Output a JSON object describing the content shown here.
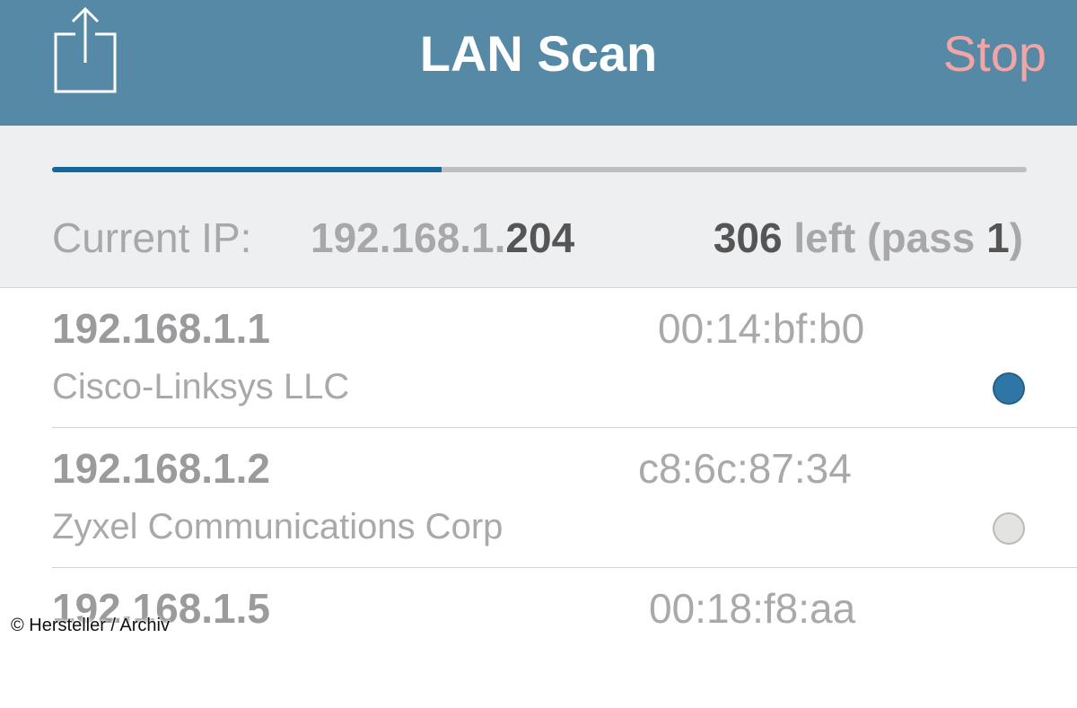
{
  "nav": {
    "title": "LAN Scan",
    "stop_label": "Stop",
    "share_icon": "share-icon"
  },
  "status": {
    "progress_fraction": 0.4,
    "current_ip_label": "Current IP:",
    "ip_prefix": "192.168.1.",
    "ip_suffix": "204",
    "left_count": "306",
    "left_text": " left (pass ",
    "pass_number": "1",
    "close_paren": ")"
  },
  "devices": [
    {
      "ip": "192.168.1.1",
      "mac": "00:14:bf:b0",
      "vendor": "Cisco-Linksys LLC",
      "status_color": "#2e76a6"
    },
    {
      "ip": "192.168.1.2",
      "mac": "c8:6c:87:34",
      "vendor": "Zyxel Communications Corp",
      "status_color": "#e3e3e1"
    },
    {
      "ip": "192.168.1.5",
      "mac": "00:18:f8:aa",
      "vendor": "",
      "status_color": ""
    }
  ],
  "watermark": "© Hersteller / Archiv",
  "colors": {
    "navbar": "#5589a6",
    "progress": "#17689a",
    "stop": "#f2a5a5"
  }
}
